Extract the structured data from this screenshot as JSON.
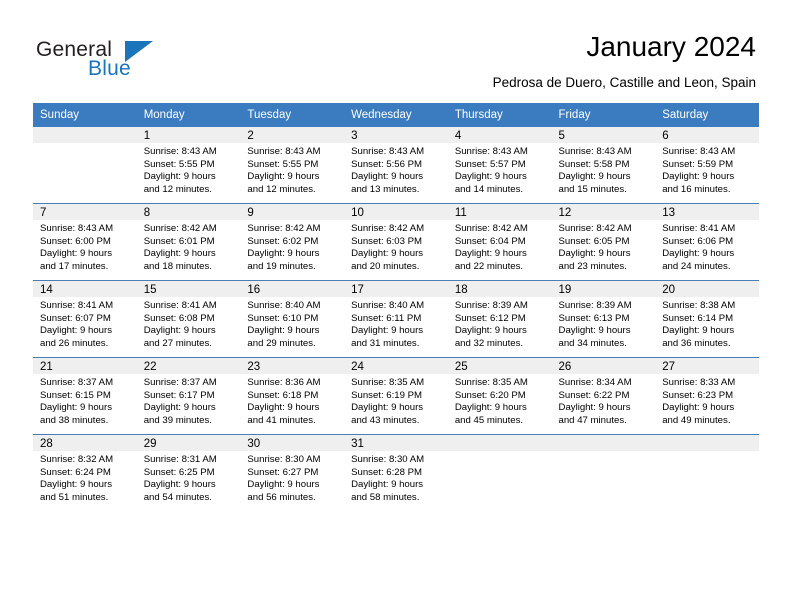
{
  "brand": {
    "name_part1": "General",
    "name_part2": "Blue",
    "triangle_icon": "triangle-icon",
    "accent_color": "#1b75bb"
  },
  "header": {
    "title": "January 2024",
    "subtitle": "Pedrosa de Duero, Castille and Leon, Spain"
  },
  "calendar": {
    "header_bg": "#3a7cbf",
    "daynum_bg": "#efefef",
    "grid_line": "#4a7fb5",
    "weekday_headers": [
      "Sunday",
      "Monday",
      "Tuesday",
      "Wednesday",
      "Thursday",
      "Friday",
      "Saturday"
    ],
    "weeks": [
      [
        {
          "day": "",
          "sunrise": "",
          "sunset": "",
          "daylight_line1": "",
          "daylight_line2": ""
        },
        {
          "day": "1",
          "sunrise": "Sunrise: 8:43 AM",
          "sunset": "Sunset: 5:55 PM",
          "daylight_line1": "Daylight: 9 hours",
          "daylight_line2": "and 12 minutes."
        },
        {
          "day": "2",
          "sunrise": "Sunrise: 8:43 AM",
          "sunset": "Sunset: 5:55 PM",
          "daylight_line1": "Daylight: 9 hours",
          "daylight_line2": "and 12 minutes."
        },
        {
          "day": "3",
          "sunrise": "Sunrise: 8:43 AM",
          "sunset": "Sunset: 5:56 PM",
          "daylight_line1": "Daylight: 9 hours",
          "daylight_line2": "and 13 minutes."
        },
        {
          "day": "4",
          "sunrise": "Sunrise: 8:43 AM",
          "sunset": "Sunset: 5:57 PM",
          "daylight_line1": "Daylight: 9 hours",
          "daylight_line2": "and 14 minutes."
        },
        {
          "day": "5",
          "sunrise": "Sunrise: 8:43 AM",
          "sunset": "Sunset: 5:58 PM",
          "daylight_line1": "Daylight: 9 hours",
          "daylight_line2": "and 15 minutes."
        },
        {
          "day": "6",
          "sunrise": "Sunrise: 8:43 AM",
          "sunset": "Sunset: 5:59 PM",
          "daylight_line1": "Daylight: 9 hours",
          "daylight_line2": "and 16 minutes."
        }
      ],
      [
        {
          "day": "7",
          "sunrise": "Sunrise: 8:43 AM",
          "sunset": "Sunset: 6:00 PM",
          "daylight_line1": "Daylight: 9 hours",
          "daylight_line2": "and 17 minutes."
        },
        {
          "day": "8",
          "sunrise": "Sunrise: 8:42 AM",
          "sunset": "Sunset: 6:01 PM",
          "daylight_line1": "Daylight: 9 hours",
          "daylight_line2": "and 18 minutes."
        },
        {
          "day": "9",
          "sunrise": "Sunrise: 8:42 AM",
          "sunset": "Sunset: 6:02 PM",
          "daylight_line1": "Daylight: 9 hours",
          "daylight_line2": "and 19 minutes."
        },
        {
          "day": "10",
          "sunrise": "Sunrise: 8:42 AM",
          "sunset": "Sunset: 6:03 PM",
          "daylight_line1": "Daylight: 9 hours",
          "daylight_line2": "and 20 minutes."
        },
        {
          "day": "11",
          "sunrise": "Sunrise: 8:42 AM",
          "sunset": "Sunset: 6:04 PM",
          "daylight_line1": "Daylight: 9 hours",
          "daylight_line2": "and 22 minutes."
        },
        {
          "day": "12",
          "sunrise": "Sunrise: 8:42 AM",
          "sunset": "Sunset: 6:05 PM",
          "daylight_line1": "Daylight: 9 hours",
          "daylight_line2": "and 23 minutes."
        },
        {
          "day": "13",
          "sunrise": "Sunrise: 8:41 AM",
          "sunset": "Sunset: 6:06 PM",
          "daylight_line1": "Daylight: 9 hours",
          "daylight_line2": "and 24 minutes."
        }
      ],
      [
        {
          "day": "14",
          "sunrise": "Sunrise: 8:41 AM",
          "sunset": "Sunset: 6:07 PM",
          "daylight_line1": "Daylight: 9 hours",
          "daylight_line2": "and 26 minutes."
        },
        {
          "day": "15",
          "sunrise": "Sunrise: 8:41 AM",
          "sunset": "Sunset: 6:08 PM",
          "daylight_line1": "Daylight: 9 hours",
          "daylight_line2": "and 27 minutes."
        },
        {
          "day": "16",
          "sunrise": "Sunrise: 8:40 AM",
          "sunset": "Sunset: 6:10 PM",
          "daylight_line1": "Daylight: 9 hours",
          "daylight_line2": "and 29 minutes."
        },
        {
          "day": "17",
          "sunrise": "Sunrise: 8:40 AM",
          "sunset": "Sunset: 6:11 PM",
          "daylight_line1": "Daylight: 9 hours",
          "daylight_line2": "and 31 minutes."
        },
        {
          "day": "18",
          "sunrise": "Sunrise: 8:39 AM",
          "sunset": "Sunset: 6:12 PM",
          "daylight_line1": "Daylight: 9 hours",
          "daylight_line2": "and 32 minutes."
        },
        {
          "day": "19",
          "sunrise": "Sunrise: 8:39 AM",
          "sunset": "Sunset: 6:13 PM",
          "daylight_line1": "Daylight: 9 hours",
          "daylight_line2": "and 34 minutes."
        },
        {
          "day": "20",
          "sunrise": "Sunrise: 8:38 AM",
          "sunset": "Sunset: 6:14 PM",
          "daylight_line1": "Daylight: 9 hours",
          "daylight_line2": "and 36 minutes."
        }
      ],
      [
        {
          "day": "21",
          "sunrise": "Sunrise: 8:37 AM",
          "sunset": "Sunset: 6:15 PM",
          "daylight_line1": "Daylight: 9 hours",
          "daylight_line2": "and 38 minutes."
        },
        {
          "day": "22",
          "sunrise": "Sunrise: 8:37 AM",
          "sunset": "Sunset: 6:17 PM",
          "daylight_line1": "Daylight: 9 hours",
          "daylight_line2": "and 39 minutes."
        },
        {
          "day": "23",
          "sunrise": "Sunrise: 8:36 AM",
          "sunset": "Sunset: 6:18 PM",
          "daylight_line1": "Daylight: 9 hours",
          "daylight_line2": "and 41 minutes."
        },
        {
          "day": "24",
          "sunrise": "Sunrise: 8:35 AM",
          "sunset": "Sunset: 6:19 PM",
          "daylight_line1": "Daylight: 9 hours",
          "daylight_line2": "and 43 minutes."
        },
        {
          "day": "25",
          "sunrise": "Sunrise: 8:35 AM",
          "sunset": "Sunset: 6:20 PM",
          "daylight_line1": "Daylight: 9 hours",
          "daylight_line2": "and 45 minutes."
        },
        {
          "day": "26",
          "sunrise": "Sunrise: 8:34 AM",
          "sunset": "Sunset: 6:22 PM",
          "daylight_line1": "Daylight: 9 hours",
          "daylight_line2": "and 47 minutes."
        },
        {
          "day": "27",
          "sunrise": "Sunrise: 8:33 AM",
          "sunset": "Sunset: 6:23 PM",
          "daylight_line1": "Daylight: 9 hours",
          "daylight_line2": "and 49 minutes."
        }
      ],
      [
        {
          "day": "28",
          "sunrise": "Sunrise: 8:32 AM",
          "sunset": "Sunset: 6:24 PM",
          "daylight_line1": "Daylight: 9 hours",
          "daylight_line2": "and 51 minutes."
        },
        {
          "day": "29",
          "sunrise": "Sunrise: 8:31 AM",
          "sunset": "Sunset: 6:25 PM",
          "daylight_line1": "Daylight: 9 hours",
          "daylight_line2": "and 54 minutes."
        },
        {
          "day": "30",
          "sunrise": "Sunrise: 8:30 AM",
          "sunset": "Sunset: 6:27 PM",
          "daylight_line1": "Daylight: 9 hours",
          "daylight_line2": "and 56 minutes."
        },
        {
          "day": "31",
          "sunrise": "Sunrise: 8:30 AM",
          "sunset": "Sunset: 6:28 PM",
          "daylight_line1": "Daylight: 9 hours",
          "daylight_line2": "and 58 minutes."
        },
        {
          "day": "",
          "sunrise": "",
          "sunset": "",
          "daylight_line1": "",
          "daylight_line2": ""
        },
        {
          "day": "",
          "sunrise": "",
          "sunset": "",
          "daylight_line1": "",
          "daylight_line2": ""
        },
        {
          "day": "",
          "sunrise": "",
          "sunset": "",
          "daylight_line1": "",
          "daylight_line2": ""
        }
      ]
    ]
  }
}
